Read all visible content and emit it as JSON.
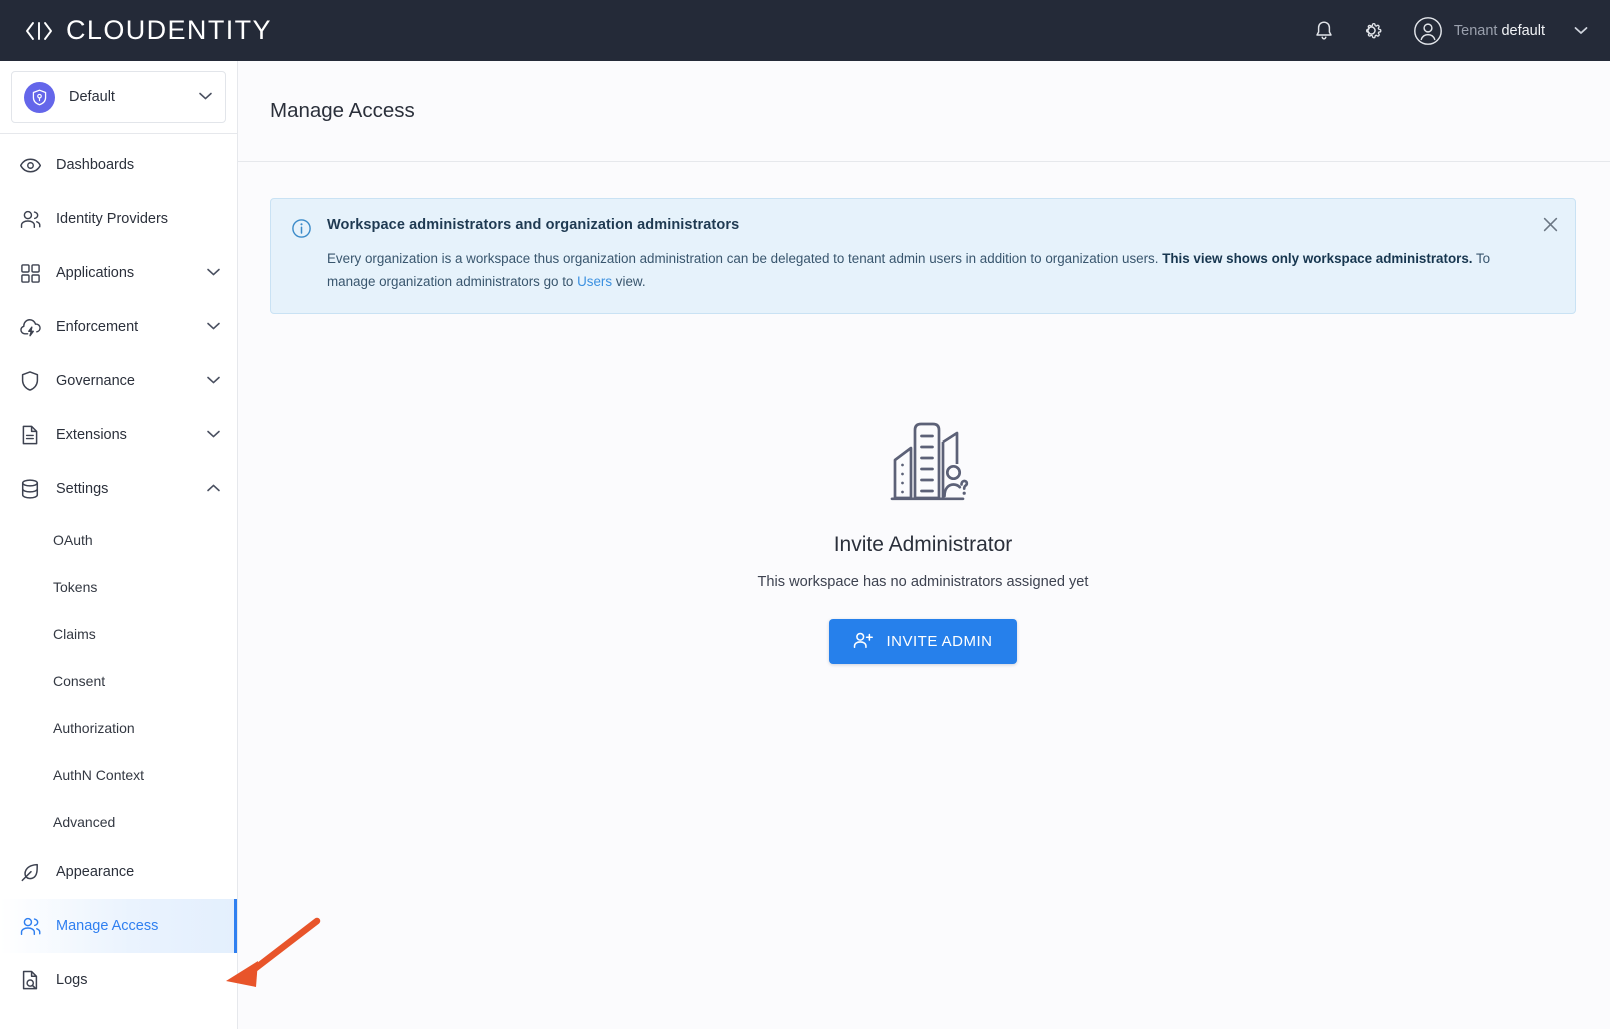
{
  "header": {
    "logo_text": "CLOUDENTITY",
    "logo_icon": "code-brackets-icon",
    "notifications_icon": "bell-icon",
    "settings_icon": "gear-icon",
    "avatar_icon": "user-avatar-icon",
    "tenant_prefix": "Tenant",
    "tenant_name": "default",
    "tenant_caret_icon": "caret-down-icon"
  },
  "sidebar": {
    "workspace": {
      "name": "Default",
      "badge_icon": "shield-key-icon",
      "caret_icon": "chevron-down-icon"
    },
    "items": [
      {
        "label": "Dashboards",
        "icon": "eye-icon",
        "expandable": false,
        "selected": false
      },
      {
        "label": "Identity Providers",
        "icon": "users-icon",
        "expandable": false,
        "selected": false
      },
      {
        "label": "Applications",
        "icon": "grid-icon",
        "expandable": true,
        "expanded": false,
        "selected": false
      },
      {
        "label": "Enforcement",
        "icon": "cloud-bolt-icon",
        "expandable": true,
        "expanded": false,
        "selected": false
      },
      {
        "label": "Governance",
        "icon": "shield-icon",
        "expandable": true,
        "expanded": false,
        "selected": false
      },
      {
        "label": "Extensions",
        "icon": "document-icon",
        "expandable": true,
        "expanded": false,
        "selected": false
      },
      {
        "label": "Settings",
        "icon": "database-icon",
        "expandable": true,
        "expanded": true,
        "selected": false
      },
      {
        "label": "Appearance",
        "icon": "feather-icon",
        "expandable": false,
        "selected": false
      },
      {
        "label": "Manage Access",
        "icon": "users-icon",
        "expandable": false,
        "selected": true
      },
      {
        "label": "Logs",
        "icon": "log-search-icon",
        "expandable": false,
        "selected": false
      }
    ],
    "settings_subitems": [
      {
        "label": "OAuth"
      },
      {
        "label": "Tokens"
      },
      {
        "label": "Claims"
      },
      {
        "label": "Consent"
      },
      {
        "label": "Authorization"
      },
      {
        "label": "AuthN Context"
      },
      {
        "label": "Advanced"
      }
    ]
  },
  "main": {
    "page_title": "Manage Access",
    "alert": {
      "icon": "info-circle-icon",
      "close_icon": "close-icon",
      "title": "Workspace administrators and organization administrators",
      "text_part1": "Every organization is a workspace thus organization administration can be delegated to tenant admin users in addition to organization users. ",
      "text_bold": "This view shows only workspace administrators.",
      "text_part2": " To manage organization administrators go to ",
      "link_text": "Users",
      "text_part3": " view."
    },
    "empty_state": {
      "illustration_icon": "office-buildings-person-question-icon",
      "title": "Invite Administrator",
      "subtitle": "This workspace has no administrators assigned yet",
      "button_label": "INVITE ADMIN",
      "button_icon": "person-add-icon"
    }
  },
  "annotation": {
    "arrow_icon": "pointer-arrow-icon",
    "arrow_color": "#e8542a"
  },
  "colors": {
    "topbar_bg": "#242a38",
    "accent_blue": "#2680eb",
    "selected_blue": "#2f7ff0",
    "workspace_purple": "#6466ea",
    "alert_bg": "#e6f2fb",
    "main_bg": "#fbfbfd",
    "annotation_orange": "#e8542a"
  }
}
